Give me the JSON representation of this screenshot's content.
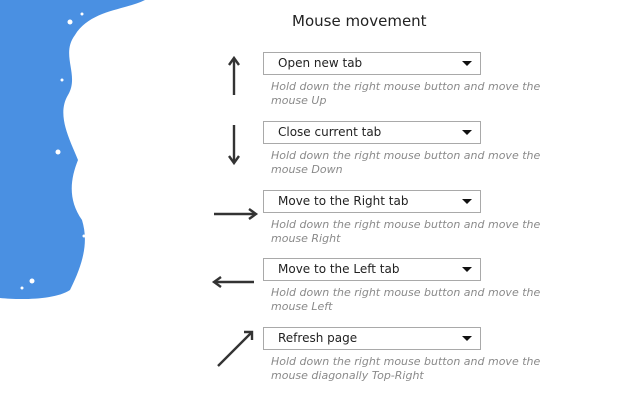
{
  "title": "Mouse movement",
  "colors": {
    "accent": "#4a90e2",
    "arrow": "#333333"
  },
  "gestures": [
    {
      "direction": "up",
      "icon": "arrow-up-icon",
      "selected": "Open new tab",
      "description": "Hold down the right mouse button and move the mouse Up"
    },
    {
      "direction": "down",
      "icon": "arrow-down-icon",
      "selected": "Close current tab",
      "description": "Hold down the right mouse button and move the mouse Down"
    },
    {
      "direction": "right",
      "icon": "arrow-right-icon",
      "selected": "Move to the Right tab",
      "description": "Hold down the right mouse button and move the mouse Right"
    },
    {
      "direction": "left",
      "icon": "arrow-left-icon",
      "selected": "Move to the Left tab",
      "description": "Hold down the right mouse button and move the mouse Left"
    },
    {
      "direction": "top-right",
      "icon": "arrow-top-right-icon",
      "selected": "Refresh page",
      "description": "Hold down the right mouse button and move the mouse diagonally Top-Right"
    }
  ]
}
